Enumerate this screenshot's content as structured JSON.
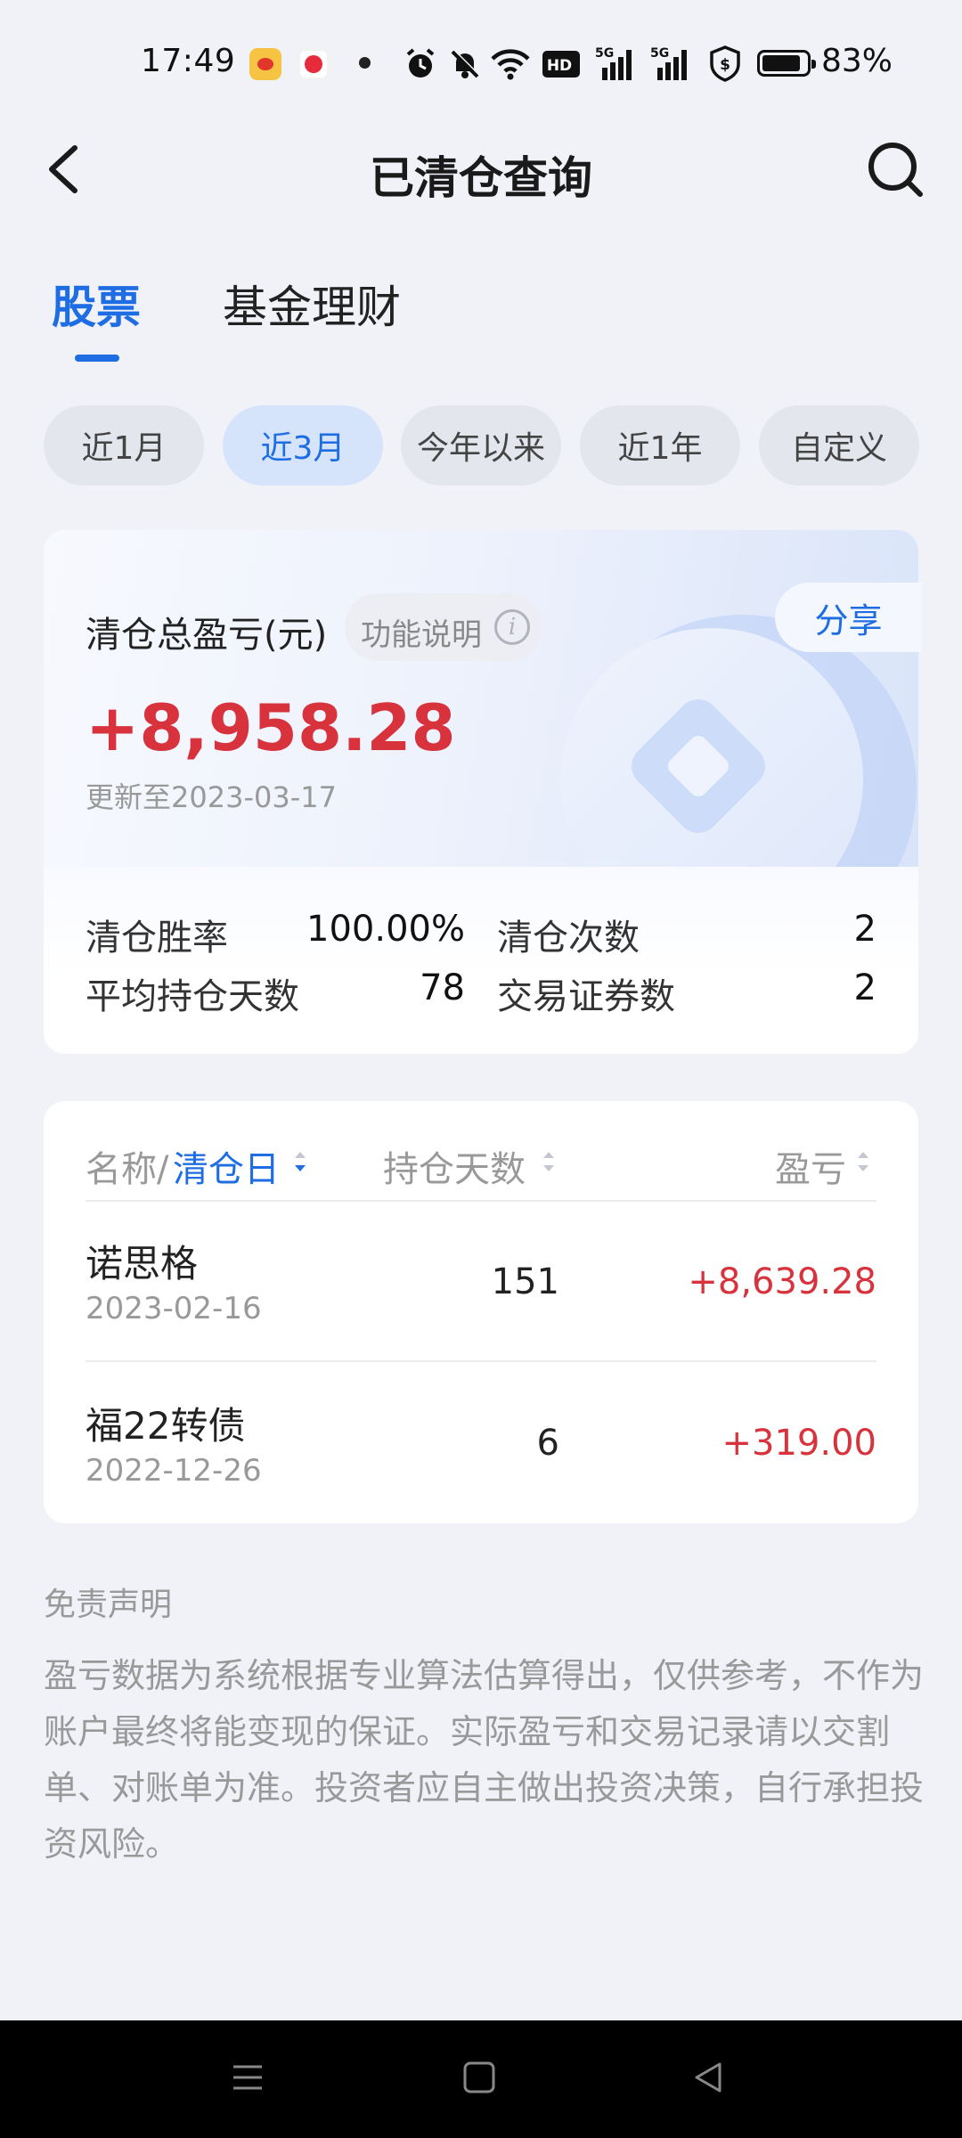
{
  "status_bar": {
    "time": "17:49",
    "icons": [
      "weibo-app-icon",
      "video-app-icon",
      "notification-dot",
      "alarm-icon",
      "mute-icon",
      "wifi-icon",
      "hd-icon",
      "5g-signal-icon",
      "5g-signal-icon",
      "shield-icon",
      "battery-icon"
    ],
    "battery": "83%"
  },
  "header": {
    "title": "已清仓查询",
    "back_icon": "chevron-left-icon",
    "search_icon": "search-icon"
  },
  "tabs": [
    {
      "label": "股票",
      "active": true
    },
    {
      "label": "基金理财",
      "active": false
    }
  ],
  "period_chips": [
    {
      "label": "近1月",
      "active": false
    },
    {
      "label": "近3月",
      "active": true
    },
    {
      "label": "今年以来",
      "active": false
    },
    {
      "label": "近1年",
      "active": false
    },
    {
      "label": "自定义",
      "active": false
    }
  ],
  "summary": {
    "label": "清仓总盈亏(元)",
    "func_label": "功能说明",
    "share_label": "分享",
    "total": "+8,958.28",
    "update": "更新至2023-03-17",
    "stats": {
      "win_rate_label": "清仓胜率",
      "win_rate": "100.00%",
      "count_label": "清仓次数",
      "count": "2",
      "avg_days_label": "平均持仓天数",
      "avg_days": "78",
      "securities_label": "交易证券数",
      "securities": "2"
    }
  },
  "table": {
    "col_name": "名称/",
    "col_name_sort": "清仓日",
    "col_days": "持仓天数",
    "col_pnl": "盈亏",
    "rows": [
      {
        "name": "诺思格",
        "date": "2023-02-16",
        "days": "151",
        "pnl": "+8,639.28"
      },
      {
        "name": "福22转债",
        "date": "2022-12-26",
        "days": "6",
        "pnl": "+319.00"
      }
    ]
  },
  "disclaimer": {
    "title": "免责声明",
    "text": "盈亏数据为系统根据专业算法估算得出，仅供参考，不作为账户最终将能变现的保证。实际盈亏和交易记录请以交割单、对账单为准。投资者应自主做出投资决策，自行承担投资风险。"
  },
  "colors": {
    "accent": "#1e6de3",
    "profit": "#d8323d",
    "background": "#f0f2f8"
  },
  "nav_bar": {
    "icons": [
      "menu-icon",
      "home-icon",
      "back-icon"
    ]
  }
}
